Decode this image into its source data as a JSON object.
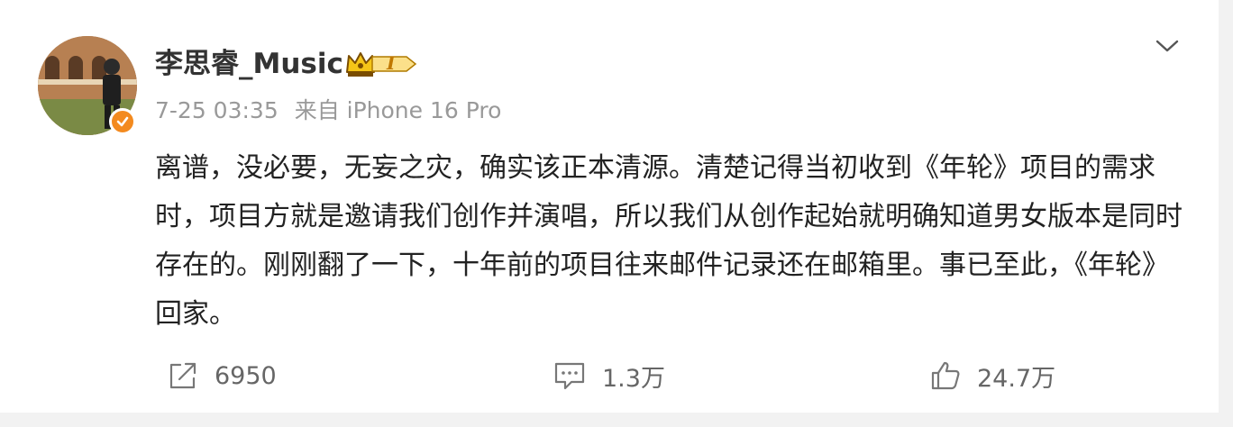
{
  "post": {
    "username": "李思睿_Music",
    "timestamp": "7-25 03:35",
    "source": "来自 iPhone 16 Pro",
    "vip_level": "I",
    "content": "离谱，没必要，无妄之灾，确实该正本清源。清楚记得当初收到《年轮》项目的需求时，项目方就是邀请我们创作并演唱，所以我们从创作起始就明确知道男女版本是同时存在的。刚刚翻了一下，十年前的项目往来邮件记录还在邮箱里。事已至此，《年轮》回家。"
  },
  "actions": {
    "repost": {
      "icon": "repost-icon",
      "count": "6950"
    },
    "comment": {
      "icon": "comment-icon",
      "count": "1.3万"
    },
    "like": {
      "icon": "thumbs-up-icon",
      "count": "24.7万"
    }
  },
  "icons": {
    "more": "chevron-down-icon",
    "verified": "verified-badge-icon",
    "vip": "crown-icon"
  },
  "colors": {
    "verified_badge": "#f38a1f",
    "vip_gold": "#f5c518",
    "text_primary": "#222222",
    "text_secondary": "#999999"
  }
}
